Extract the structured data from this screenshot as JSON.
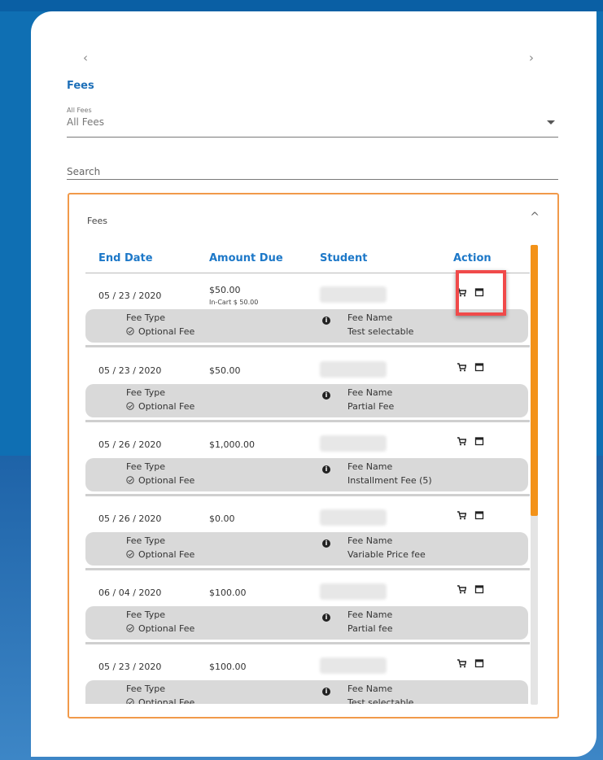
{
  "nav": {
    "prev": "‹",
    "next": "›"
  },
  "section_title": "Fees",
  "filter": {
    "label": "All Fees",
    "value": "All Fees"
  },
  "search": {
    "placeholder": "Search"
  },
  "fees_box": {
    "title": "Fees",
    "collapse": "^"
  },
  "table": {
    "headers": [
      "End Date",
      "Amount Due",
      "Student",
      "Action"
    ],
    "rows": [
      {
        "date": "05 / 23 / 2020",
        "amount": "$50.00",
        "in_cart": "In-Cart $ 50.00",
        "fee_type_label": "Fee Type",
        "fee_type": "Optional Fee",
        "fee_name_label": "Fee Name",
        "fee_name": "Test selectable"
      },
      {
        "date": "05 / 23 / 2020",
        "amount": "$50.00",
        "fee_type_label": "Fee Type",
        "fee_type": "Optional Fee",
        "fee_name_label": "Fee Name",
        "fee_name": "Partial Fee"
      },
      {
        "date": "05 / 26 / 2020",
        "amount": "$1,000.00",
        "fee_type_label": "Fee Type",
        "fee_type": "Optional Fee",
        "fee_name_label": "Fee Name",
        "fee_name": "Installment Fee (5)"
      },
      {
        "date": "05 / 26 / 2020",
        "amount": "$0.00",
        "fee_type_label": "Fee Type",
        "fee_type": "Optional Fee",
        "fee_name_label": "Fee Name",
        "fee_name": "Variable Price fee"
      },
      {
        "date": "06 / 04 / 2020",
        "amount": "$100.00",
        "fee_type_label": "Fee Type",
        "fee_type": "Optional Fee",
        "fee_name_label": "Fee Name",
        "fee_name": "Partial fee"
      },
      {
        "date": "05 / 23 / 2020",
        "amount": "$100.00",
        "fee_type_label": "Fee Type",
        "fee_type": "Optional Fee",
        "fee_name_label": "Fee Name",
        "fee_name": "Test selectable"
      }
    ]
  },
  "icons": {
    "cart": "cart-icon",
    "calendar": "calendar-icon",
    "check": "check-circle-icon",
    "info": "info-icon"
  },
  "colors": {
    "accent": "#1d78c8",
    "border_orange": "#f19a4a",
    "scroll_thumb": "#f39218",
    "highlight": "#f04a4a"
  }
}
